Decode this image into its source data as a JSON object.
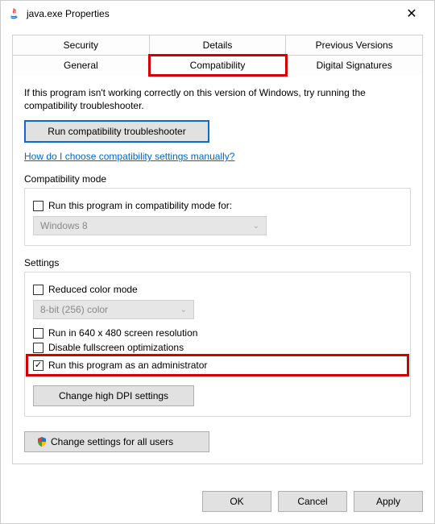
{
  "window": {
    "title": "java.exe Properties"
  },
  "tabs": {
    "row1": [
      "Security",
      "Details",
      "Previous Versions"
    ],
    "row2": [
      "General",
      "Compatibility",
      "Digital Signatures"
    ],
    "active": "Compatibility"
  },
  "content": {
    "intro": "If this program isn't working correctly on this version of Windows, try running the compatibility troubleshooter.",
    "troubleshoot_btn": "Run compatibility troubleshooter",
    "manual_link": "How do I choose compatibility settings manually?",
    "compat_mode": {
      "label": "Compatibility mode",
      "checkbox": "Run this program in compatibility mode for:",
      "combo": "Windows 8"
    },
    "settings": {
      "label": "Settings",
      "reduced_color": "Reduced color mode",
      "color_combo": "8-bit (256) color",
      "run_640": "Run in 640 x 480 screen resolution",
      "disable_fullscreen": "Disable fullscreen optimizations",
      "run_admin": "Run this program as an administrator",
      "change_dpi": "Change high DPI settings"
    },
    "all_users_btn": "Change settings for all users"
  },
  "footer": {
    "ok": "OK",
    "cancel": "Cancel",
    "apply": "Apply"
  }
}
